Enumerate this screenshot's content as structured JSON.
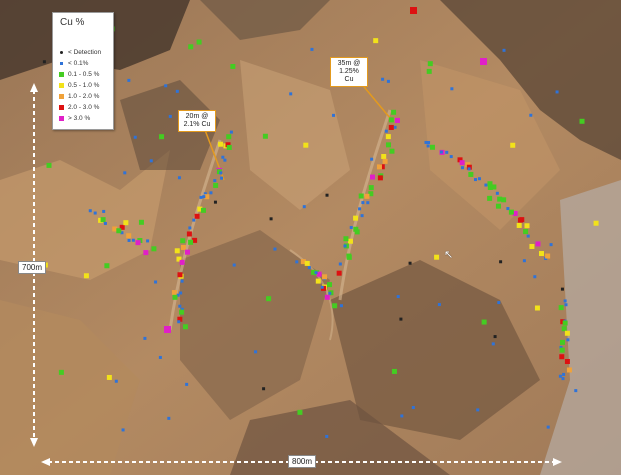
{
  "legend": {
    "title": "Cu %",
    "items": [
      {
        "label": "< Detection",
        "color": "#222222",
        "kind": "dot"
      },
      {
        "label": "< 0.1%",
        "color": "#2f73d8",
        "kind": "dot"
      },
      {
        "label": "0.1 - 0.5 %",
        "color": "#44cc22",
        "kind": "square"
      },
      {
        "label": "0.5 - 1.0 %",
        "color": "#f2e21a",
        "kind": "square"
      },
      {
        "label": "1.0 - 2.0 %",
        "color": "#f0a23a",
        "kind": "square"
      },
      {
        "label": "2.0 - 3.0 %",
        "color": "#dd1111",
        "kind": "square"
      },
      {
        "label": "> 3.0 %",
        "color": "#e020c8",
        "kind": "square"
      }
    ]
  },
  "callouts": [
    {
      "line1": "20m @",
      "line2": "2.1% Cu"
    },
    {
      "line1": "35m @",
      "line2": "1.25% Cu"
    }
  ],
  "scale": {
    "vertical": "700m",
    "horizontal": "800m"
  },
  "marker_colors": {
    "top": "#dd1111",
    "upper_right": "#e020c8",
    "left": "#e020c8"
  },
  "callout_border": "#e39a1e"
}
